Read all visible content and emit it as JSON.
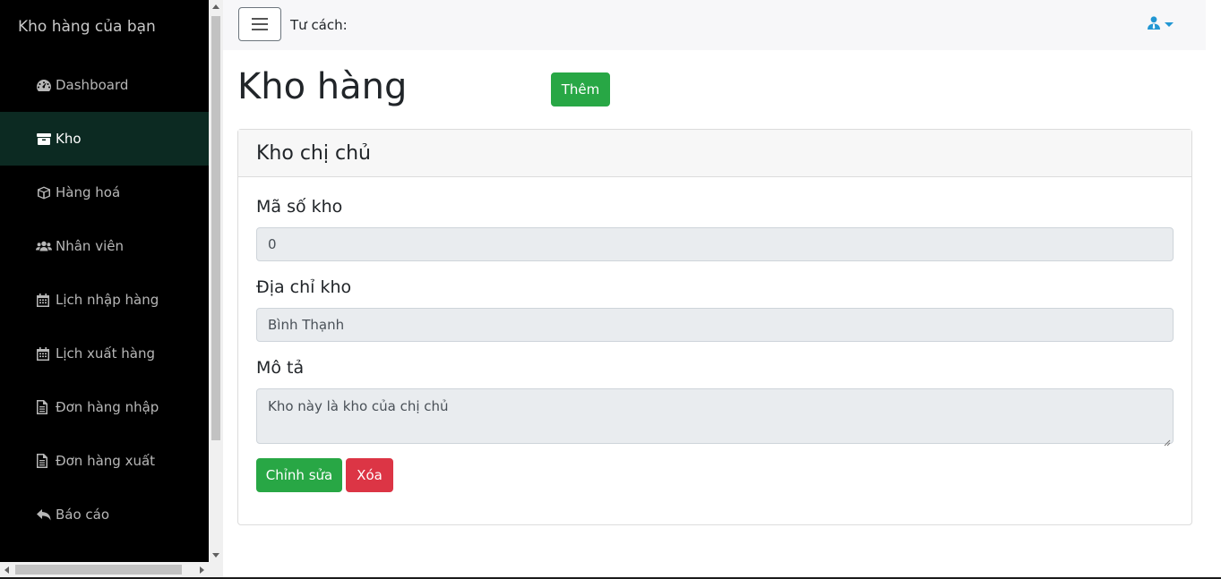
{
  "sidebar": {
    "brand": "Kho hàng của bạn",
    "items": [
      {
        "label": "Dashboard",
        "icon": "tachometer-icon"
      },
      {
        "label": "Kho",
        "icon": "warehouse-box-icon",
        "active": true
      },
      {
        "label": "Hàng hoá",
        "icon": "cube-icon"
      },
      {
        "label": "Nhân viên",
        "icon": "users-icon"
      },
      {
        "label": "Lịch nhập hàng",
        "icon": "calendar-icon"
      },
      {
        "label": "Lịch xuất hàng",
        "icon": "calendar-icon"
      },
      {
        "label": "Đơn hàng nhập",
        "icon": "file-text-icon"
      },
      {
        "label": "Đơn hàng xuất",
        "icon": "file-text-icon"
      },
      {
        "label": "Báo cáo",
        "icon": "reply-icon"
      }
    ]
  },
  "topbar": {
    "toggle_icon": "hamburger-icon",
    "role_label": "Tư cách:",
    "user_icon": "user-tie-icon",
    "accent": "#2196d3"
  },
  "page": {
    "title": "Kho hàng",
    "add_label": "Thêm"
  },
  "card": {
    "title": "Kho chị chủ",
    "fields": {
      "code_label": "Mã số kho",
      "code_value": "0",
      "address_label": "Địa chỉ kho",
      "address_value": "Bình Thạnh",
      "description_label": "Mô tả",
      "description_value": "Kho này là kho của chị chủ"
    },
    "edit_label": "Chỉnh sửa",
    "delete_label": "Xóa"
  },
  "colors": {
    "sidebar_bg": "#000000",
    "active_item_bg": "#0c2a22",
    "success": "#28a745",
    "danger": "#dc3545"
  }
}
